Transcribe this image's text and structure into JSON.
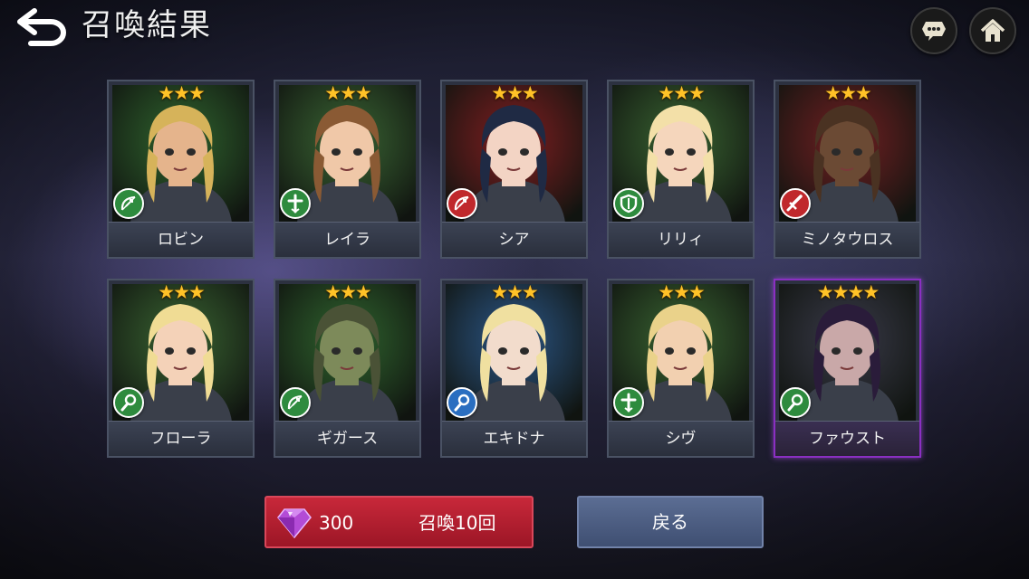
{
  "header": {
    "title": "召喚結果",
    "back_icon": "back-arrow-icon",
    "chat_icon": "chat-bubble-icon",
    "home_icon": "home-icon"
  },
  "cards": [
    {
      "name": "ロビン",
      "stars": "★★★",
      "rarity": 3,
      "class": "bow",
      "class_color": "#2e8b3e",
      "bg": "#2f6a2a",
      "skin": "#e5b48c",
      "hair": "#d6b35a"
    },
    {
      "name": "レイラ",
      "stars": "★★★",
      "rarity": 3,
      "class": "cross",
      "class_color": "#2e8b3e",
      "bg": "#3b6b30",
      "skin": "#f0c8a8",
      "hair": "#8a5a34"
    },
    {
      "name": "シア",
      "stars": "★★★",
      "rarity": 3,
      "class": "bow",
      "class_color": "#c0282c",
      "bg": "#8a1a1a",
      "skin": "#f3d4c4",
      "hair": "#1f2a44"
    },
    {
      "name": "リリィ",
      "stars": "★★★",
      "rarity": 3,
      "class": "shield",
      "class_color": "#2e8b3e",
      "bg": "#3a6a2e",
      "skin": "#f5d6bc",
      "hair": "#f3e0a8"
    },
    {
      "name": "ミノタウロス",
      "stars": "★★★",
      "rarity": 3,
      "class": "sword",
      "class_color": "#c0282c",
      "bg": "#7a1c1c",
      "skin": "#6b4a34",
      "hair": "#4a3222"
    },
    {
      "name": "フローラ",
      "stars": "★★★",
      "rarity": 3,
      "class": "staff",
      "class_color": "#2e8b3e",
      "bg": "#3a6a2e",
      "skin": "#f4d2b8",
      "hair": "#f0dc94"
    },
    {
      "name": "ギガース",
      "stars": "★★★",
      "rarity": 3,
      "class": "bow",
      "class_color": "#2e8b3e",
      "bg": "#2f6a2a",
      "skin": "#7d8a5a",
      "hair": "#4a5236"
    },
    {
      "name": "エキドナ",
      "stars": "★★★",
      "rarity": 3,
      "class": "staff",
      "class_color": "#2a6ec0",
      "bg": "#2a5a8e",
      "skin": "#f2dccc",
      "hair": "#f0e0a0"
    },
    {
      "name": "シヴ",
      "stars": "★★★",
      "rarity": 3,
      "class": "cross",
      "class_color": "#2e8b3e",
      "bg": "#3a6a2e",
      "skin": "#f2d0b0",
      "hair": "#ead28a"
    },
    {
      "name": "ファウスト",
      "stars": "★★★★",
      "rarity": 4,
      "class": "staff",
      "class_color": "#2e8b3e",
      "bg": "#3a3a48",
      "skin": "#c9a8a8",
      "hair": "#2a1c3a"
    }
  ],
  "summon_button": {
    "cost": "300",
    "label": "召喚10回",
    "currency_icon": "purple-gem-icon"
  },
  "return_button": {
    "label": "戻る"
  }
}
